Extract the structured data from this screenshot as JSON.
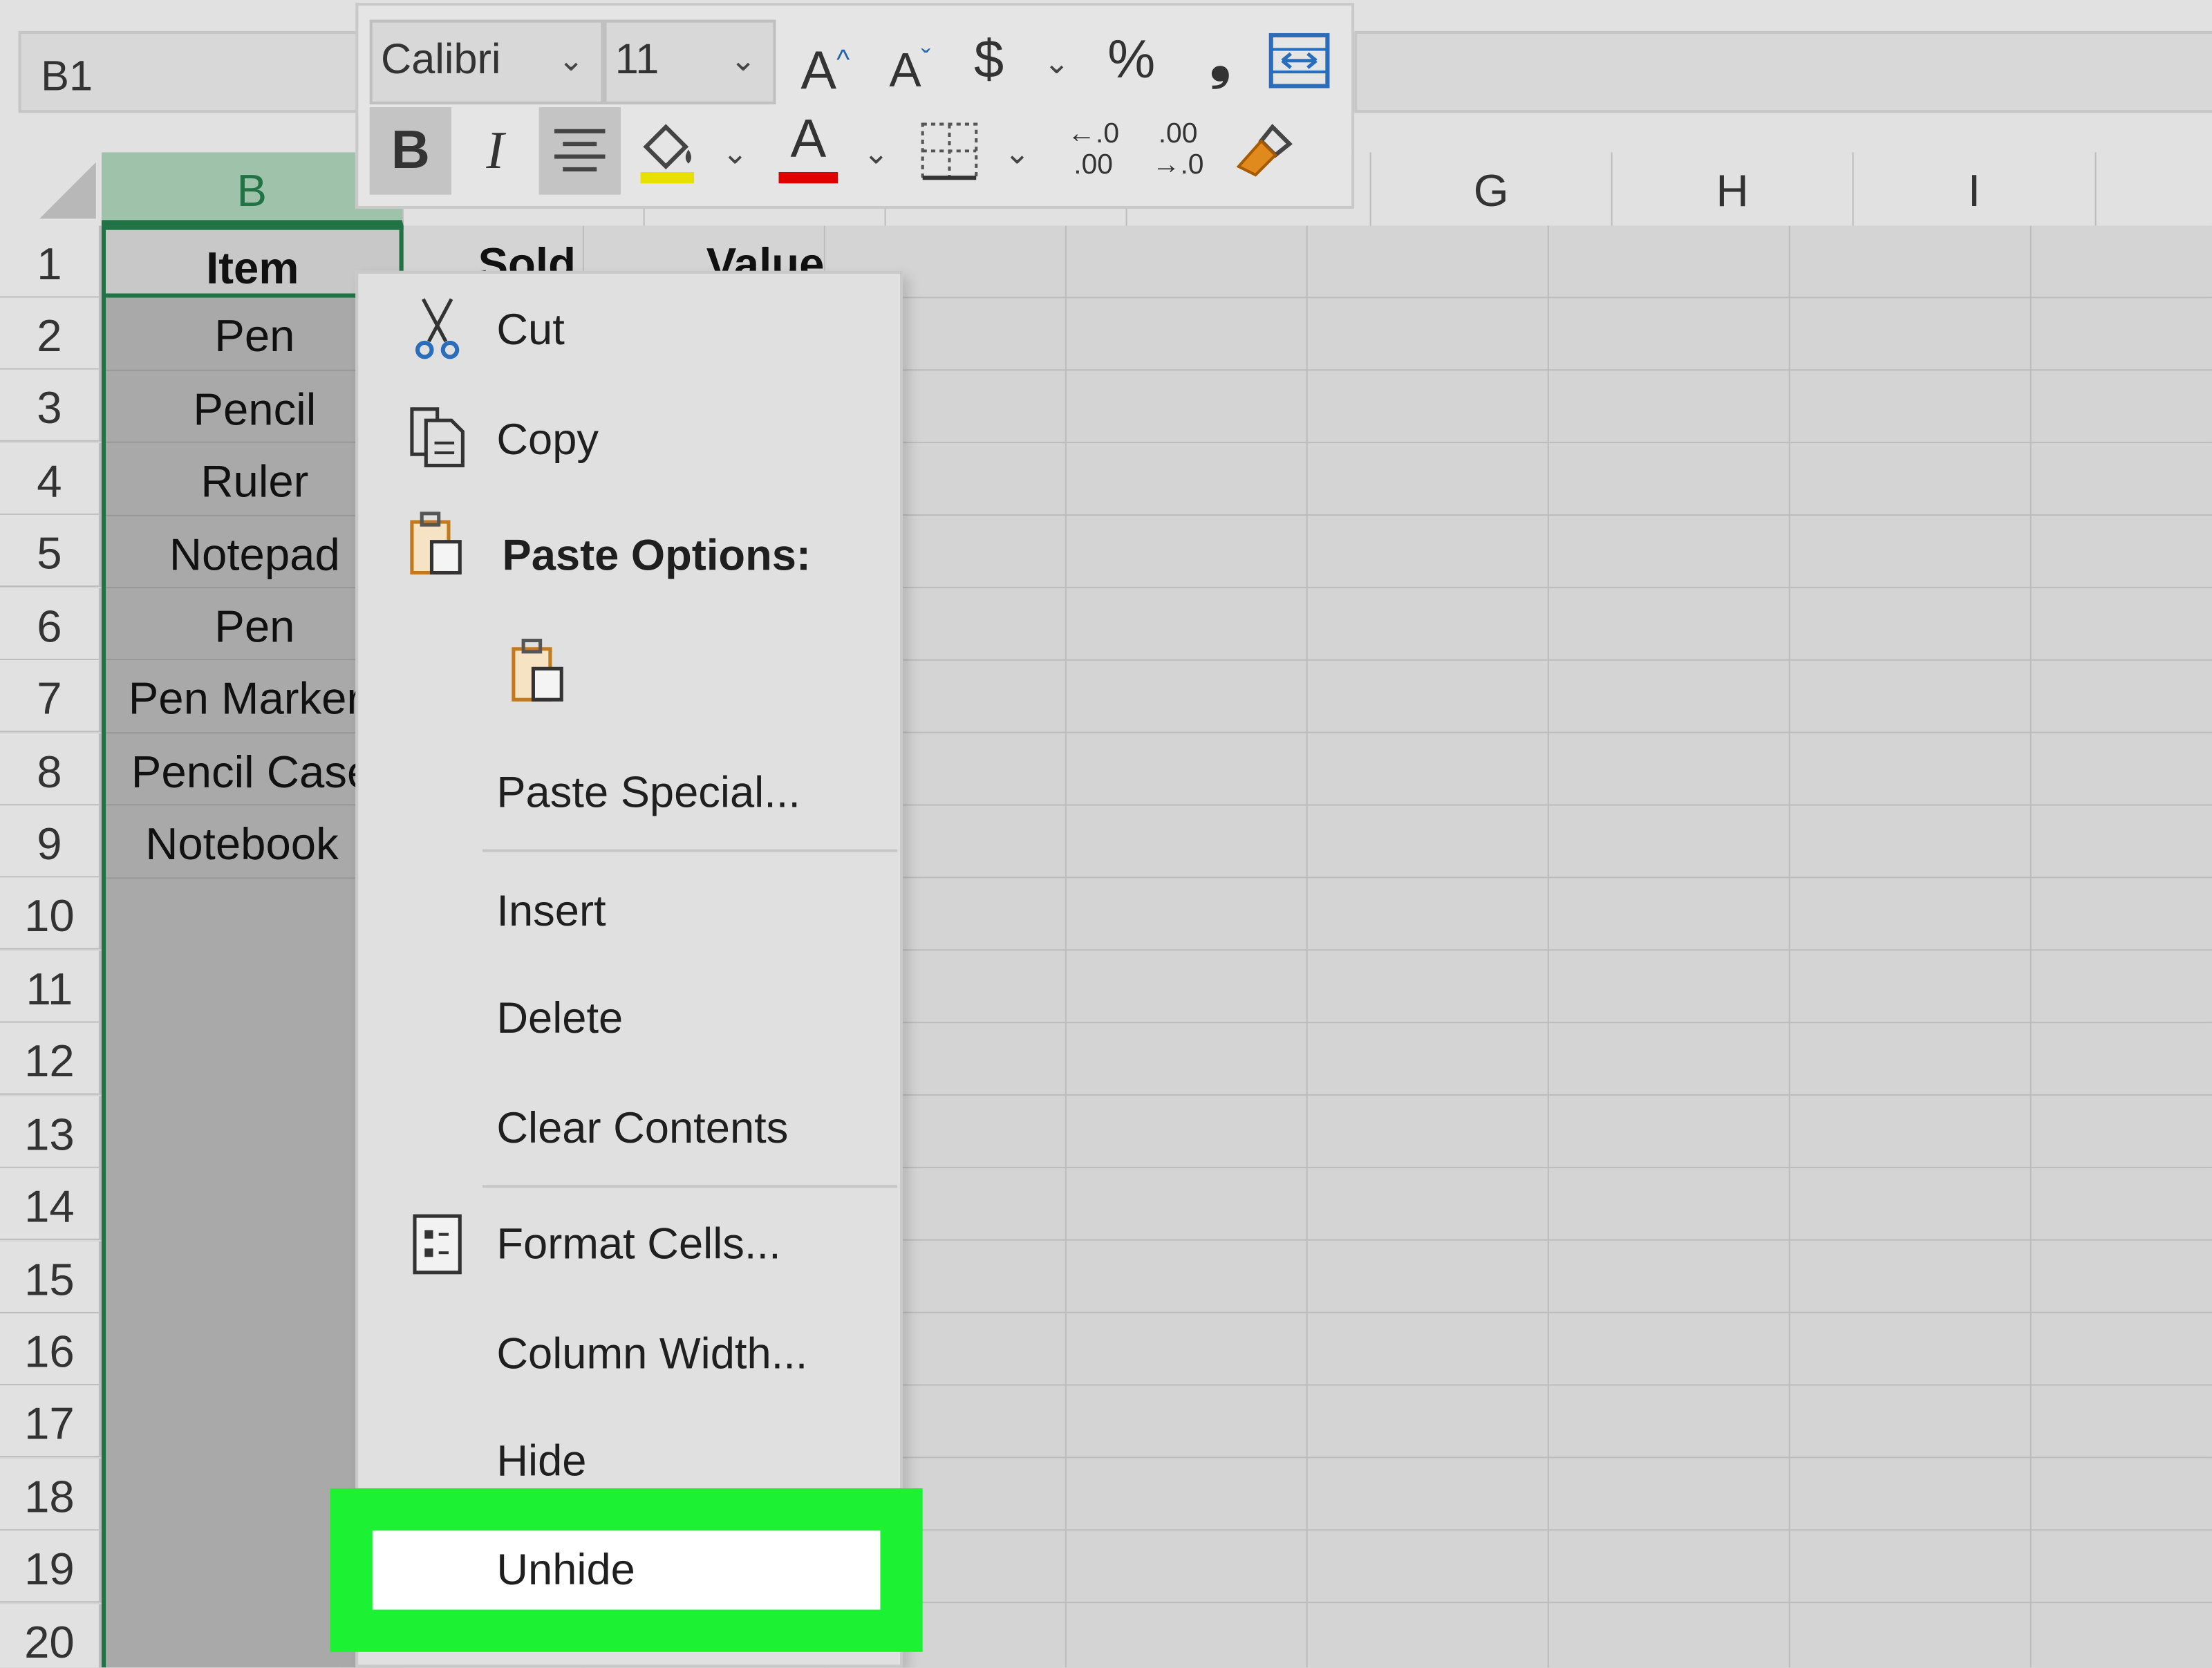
{
  "name_box": "B1",
  "toolbar": {
    "font_name": "Calibri",
    "font_size": "11",
    "grow_font": "A",
    "shrink_font": "A",
    "currency": "$",
    "percent": "%",
    "comma": "❟",
    "bold": "B",
    "italic": "I",
    "font_color": "A",
    "increase_decimal": "←.0 .00",
    "decrease_decimal": ".00 →.0",
    "fill_color_hex": "#e8e000",
    "font_color_hex": "#e00000"
  },
  "columns": [
    "B",
    "G",
    "H",
    "I"
  ],
  "rows": [
    "1",
    "2",
    "3",
    "4",
    "5",
    "6",
    "7",
    "8",
    "9",
    "10",
    "11",
    "12",
    "13",
    "14",
    "15",
    "16",
    "17",
    "18",
    "19",
    "20"
  ],
  "column_b_cells": [
    "Item",
    "Pen",
    "Pencil",
    "Ruler",
    "Notepad",
    "Pen",
    "Pen Marker",
    "Pencil Case",
    "Notebook"
  ],
  "header_cells": {
    "sold": "Sold",
    "value": "Value"
  },
  "context_menu": {
    "cut": "Cut",
    "copy": "Copy",
    "paste_options": "Paste Options:",
    "paste_special": "Paste Special...",
    "insert": "Insert",
    "delete": "Delete",
    "clear_contents": "Clear Contents",
    "format_cells": "Format Cells...",
    "column_width": "Column Width...",
    "hide": "Hide",
    "unhide": "Unhide"
  },
  "colors": {
    "selection_green": "#217346",
    "highlight": "#1cf233"
  }
}
